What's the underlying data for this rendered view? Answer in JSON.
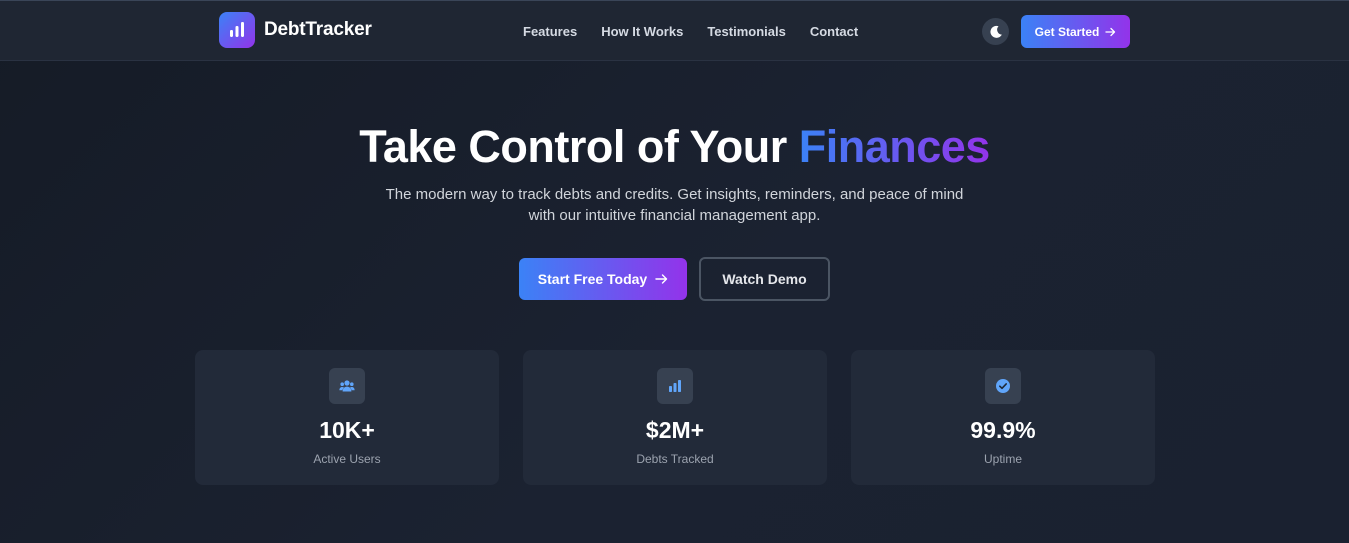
{
  "brand": {
    "name": "DebtTracker"
  },
  "nav": {
    "links": [
      "Features",
      "How It Works",
      "Testimonials",
      "Contact"
    ],
    "cta_label": "Get Started"
  },
  "hero": {
    "title_main": "Take Control of Your ",
    "title_accent": "Finances",
    "subtitle": "The modern way to track debts and credits. Get insights, reminders, and peace of mind with our intuitive financial management app.",
    "primary_button": "Start Free Today",
    "secondary_button": "Watch Demo"
  },
  "stats": [
    {
      "icon": "users-icon",
      "value": "10K+",
      "label": "Active Users"
    },
    {
      "icon": "bar-chart-icon",
      "value": "$2M+",
      "label": "Debts Tracked"
    },
    {
      "icon": "check-circle-icon",
      "value": "99.9%",
      "label": "Uptime"
    }
  ],
  "colors": {
    "background": "#1a2130",
    "navbar": "#1f2633",
    "card": "#222a39",
    "gradient_start": "#3b82f6",
    "gradient_end": "#9333ea",
    "icon_accent": "#60a5fa"
  }
}
